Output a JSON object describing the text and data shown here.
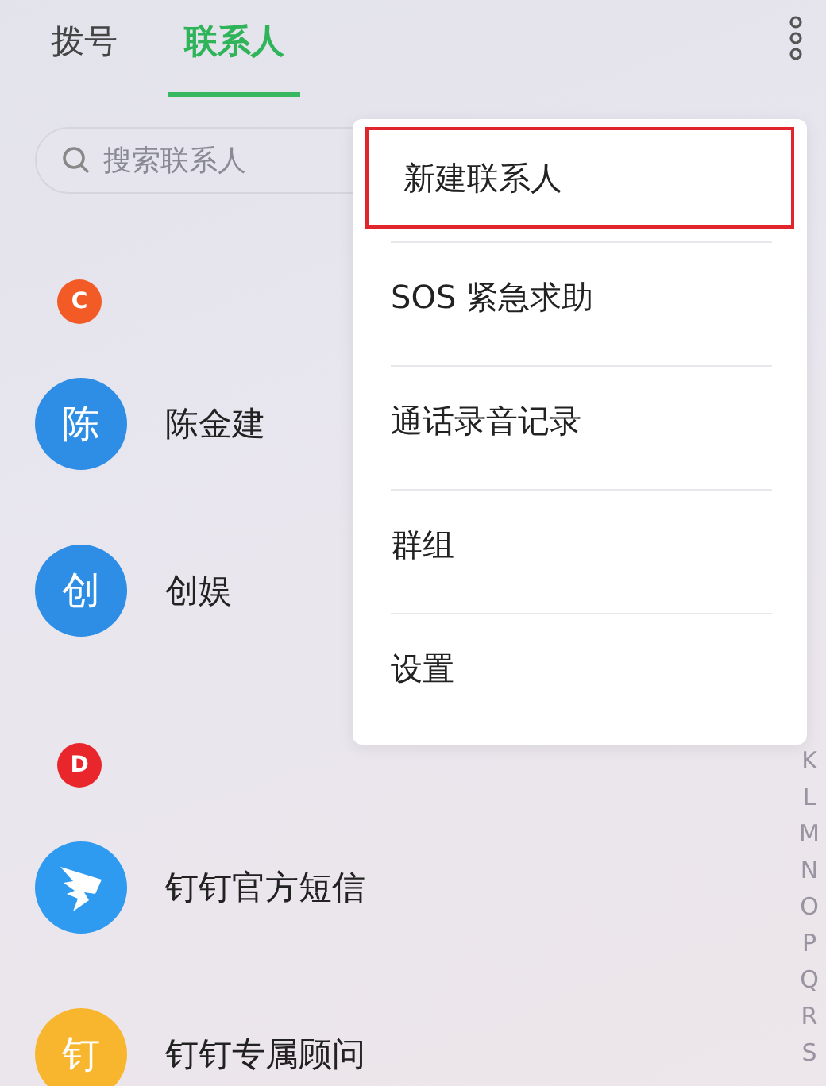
{
  "tabs": [
    {
      "label": "拨号",
      "selected": false
    },
    {
      "label": "联系人",
      "selected": true
    }
  ],
  "search": {
    "placeholder": "搜索联系人"
  },
  "sections": [
    {
      "letter": "C",
      "color": "#f25a26",
      "contacts": [
        {
          "name": "陈金建",
          "avatar": {
            "kind": "text",
            "text": "陈",
            "color": "#2e8ee6"
          }
        },
        {
          "name": "创娱",
          "avatar": {
            "kind": "text",
            "text": "创",
            "color": "#2e8ee6"
          }
        }
      ]
    },
    {
      "letter": "D",
      "color": "#e8262b",
      "contacts": [
        {
          "name": "钉钉官方短信",
          "avatar": {
            "kind": "logo",
            "color": "#2e9af0"
          }
        },
        {
          "name": "钉钉专属顾问",
          "avatar": {
            "kind": "text",
            "text": "钉",
            "color": "#f8b62e"
          }
        }
      ]
    }
  ],
  "index": [
    "K",
    "L",
    "M",
    "N",
    "O",
    "P",
    "Q",
    "R",
    "S"
  ],
  "menu": [
    {
      "label": "新建联系人",
      "highlighted": true
    },
    {
      "label": "SOS 紧急求助",
      "highlighted": false
    },
    {
      "label": "通话录音记录",
      "highlighted": false
    },
    {
      "label": "群组",
      "highlighted": false
    },
    {
      "label": "设置",
      "highlighted": false
    }
  ]
}
